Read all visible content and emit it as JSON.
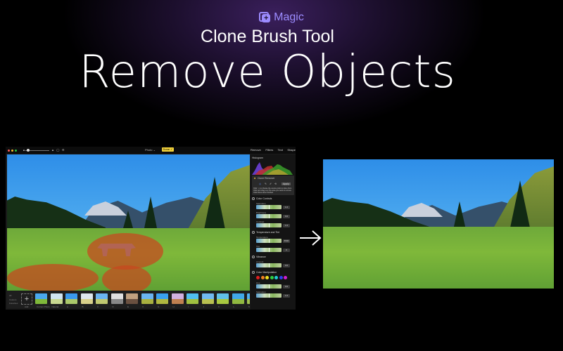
{
  "hero": {
    "badge_icon": "magic-sparkle-icon",
    "badge_label": "Magic",
    "subtitle": "Clone Brush Tool",
    "title": "Remove Objects"
  },
  "app": {
    "toolbar": {
      "photo_label": "Photo ⌄",
      "done_label": "Done ✓",
      "traffic_lights": [
        "#ff5f57",
        "#febc2e",
        "#28c840"
      ]
    },
    "right_tabs": [
      "Remove",
      "Filters",
      "Text",
      "Shape"
    ],
    "panel": {
      "histogram_label": "Histogram",
      "clone_tool": {
        "title": "Clone Remover",
        "instructions": [
          "Click ⌥ to choose the source point to clone from",
          "Click and drag over the area you want to remove",
          "Click Done when finished"
        ],
        "apply_label": "Apply"
      },
      "sections": [
        {
          "title": "Color Controls",
          "sliders": [
            {
              "label": "Saturation",
              "value": "1.0"
            },
            {
              "label": "Brightness",
              "value": "0.0"
            },
            {
              "label": "Contrast",
              "value": "1.0"
            }
          ]
        },
        {
          "title": "Temperature and Tint",
          "sliders": [
            {
              "label": "Temperature",
              "value": "6500"
            },
            {
              "label": "Tint",
              "value": "0"
            }
          ]
        },
        {
          "title": "Vibrance",
          "sliders": [
            {
              "label": "Amount",
              "value": "0.0"
            }
          ]
        },
        {
          "title": "Color Manipulation",
          "swatches": [
            "#e02020",
            "#f08020",
            "#f0e020",
            "#30d040",
            "#20d0d0",
            "#3040f0",
            "#d020d0"
          ],
          "sliders": [
            {
              "label": "Hue",
              "value": "0.0"
            },
            {
              "label": "Saturation",
              "value": "1.0"
            }
          ]
        }
      ]
    },
    "filter_strip": {
      "side_labels": [
        "All",
        "Custom",
        "Favorites"
      ],
      "add_label": "Add",
      "filters": [
        {
          "name": "Current Photo"
        },
        {
          "name": "Natural"
        },
        {
          "name": "A"
        },
        {
          "name": "B"
        },
        {
          "name": "C"
        },
        {
          "name": "D"
        },
        {
          "name": "E"
        },
        {
          "name": "F"
        },
        {
          "name": "G"
        },
        {
          "name": "H"
        },
        {
          "name": "I"
        },
        {
          "name": "J"
        },
        {
          "name": "K"
        },
        {
          "name": "L"
        },
        {
          "name": "M"
        }
      ]
    }
  },
  "comparison": {
    "arrow_icon": "arrow-right-icon",
    "before_label": "",
    "after_label": ""
  }
}
